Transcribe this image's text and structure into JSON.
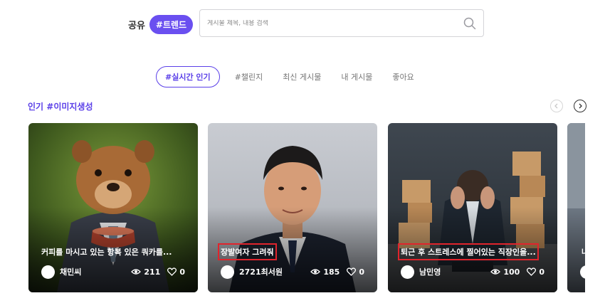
{
  "header": {
    "share_label": "공유",
    "trend_label": "#트렌드",
    "search_placeholder": "게시물 제목, 내용 검색"
  },
  "tabs": [
    {
      "label": "#실시간 인기",
      "active": true
    },
    {
      "label": "#챌린지",
      "active": false
    },
    {
      "label": "최신 게시물",
      "active": false
    },
    {
      "label": "내 게시물",
      "active": false
    },
    {
      "label": "좋아요",
      "active": false
    }
  ],
  "section": {
    "title": "인기 #이미지생성"
  },
  "cards": [
    {
      "title": "커피를 마시고 있는 항복 있은 쿼카를...",
      "author": "채민씨",
      "views": "211",
      "likes": "0",
      "image": "quokka-in-suit"
    },
    {
      "title": "장발여자 그려줘",
      "author": "2721최서원",
      "views": "185",
      "likes": "0",
      "image": "man-in-suit-portrait"
    },
    {
      "title": "퇴근 후 스트레스에 찔어있는 직장인을...",
      "author": "남민영",
      "views": "100",
      "likes": "0",
      "image": "stressed-worker-boxes"
    },
    {
      "title": "나",
      "author": "",
      "views": "",
      "likes": "",
      "image": "partial-card"
    }
  ],
  "colors": {
    "accent": "#5a3fe8",
    "pill": "#6a4ff0",
    "highlight_box": "#e0242c"
  }
}
